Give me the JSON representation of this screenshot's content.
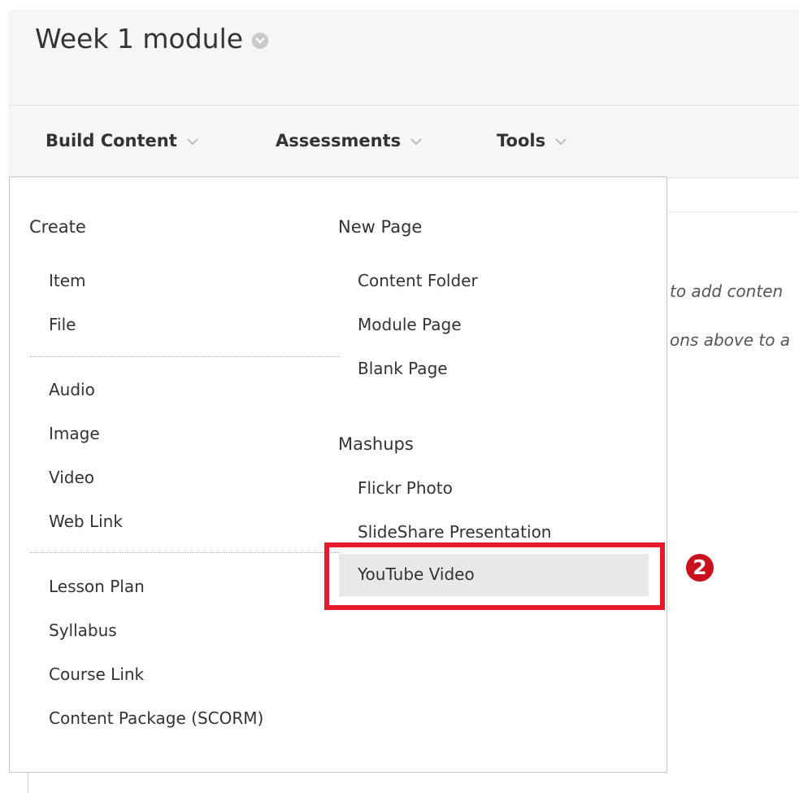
{
  "header": {
    "title": "Week 1 module",
    "title_menu_icon": "chevron-down-circle-icon"
  },
  "toolbar": {
    "menus": [
      {
        "label": "Build Content",
        "icon": "chevron-down-icon"
      },
      {
        "label": "Assessments",
        "icon": "chevron-down-icon"
      },
      {
        "label": "Tools",
        "icon": "chevron-down-icon"
      }
    ]
  },
  "background": {
    "hint_line_1": "to add conten",
    "hint_line_2": "ons above to a"
  },
  "dropdown": {
    "create": {
      "heading": "Create",
      "group1": [
        "Item",
        "File"
      ],
      "group2": [
        "Audio",
        "Image",
        "Video",
        "Web Link"
      ],
      "group3": [
        "Lesson Plan",
        "Syllabus",
        "Course Link",
        "Content Package (SCORM)"
      ]
    },
    "new_page": {
      "heading": "New Page",
      "items": [
        "Content Folder",
        "Module Page",
        "Blank Page"
      ]
    },
    "mashups": {
      "heading": "Mashups",
      "items": [
        "Flickr Photo",
        "SlideShare Presentation",
        "YouTube Video"
      ],
      "highlighted_index": 2
    }
  },
  "annotation": {
    "step_number": "2",
    "highlight_color": "#e8192c",
    "badge_color": "#c8101e"
  }
}
